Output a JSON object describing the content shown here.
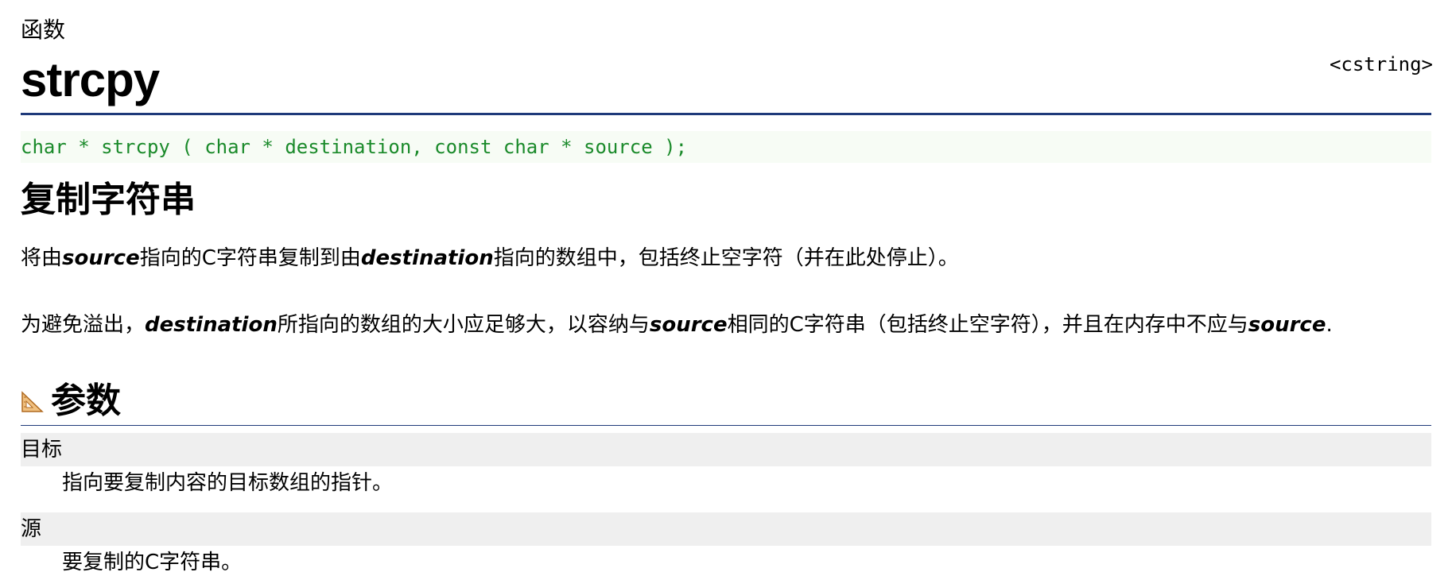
{
  "header": {
    "kind": "函数",
    "title": "strcpy",
    "library": "<cstring>"
  },
  "prototype": "char * strcpy ( char * destination, const char * source );",
  "description": {
    "heading": "复制字符串",
    "para1": {
      "t1": "将由",
      "e1": "source",
      "t2": "指向的C字符串复制到由",
      "e2": "destination",
      "t3": "指向的数组中，包括终止空字符（并在此处停止）。"
    },
    "para2": {
      "t1": "为避免溢出，",
      "e1": "destination",
      "t2": "所指向的数组的大小应足够大，以容纳与",
      "e2": "source",
      "t3": "相同的C字符串（包括终止空字符），并且在内存中不应与",
      "e3": "source",
      "t4": "."
    }
  },
  "parameters": {
    "heading": "参数",
    "icon": "ruler-triangle-icon",
    "items": [
      {
        "name": "目标",
        "desc": "指向要复制内容的目标数组的指针。"
      },
      {
        "name": "源",
        "desc": "要复制的C字符串。"
      }
    ]
  },
  "colors": {
    "rule": "#1f3a7a",
    "code": "#1a8a2a",
    "code_bg": "#f7fcf5",
    "param_bg": "#efefef"
  }
}
